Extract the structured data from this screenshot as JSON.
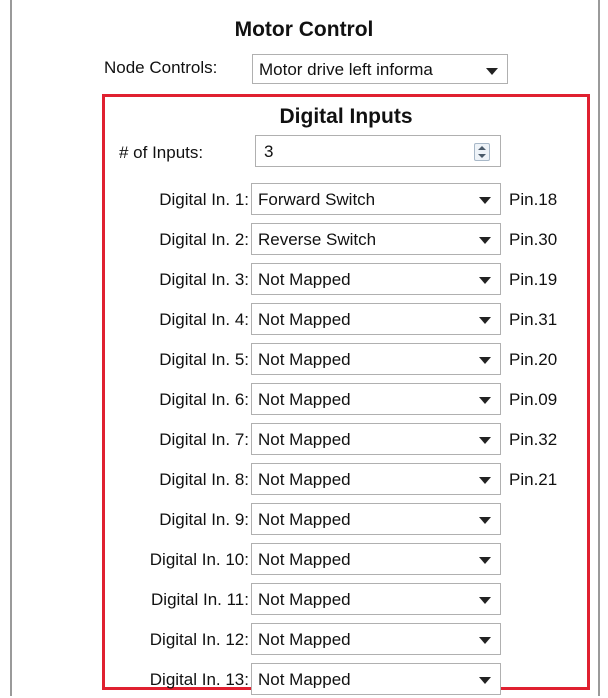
{
  "header": {
    "title": "Motor Control"
  },
  "node_controls": {
    "label": "Node Controls:",
    "value": "Motor drive left informa"
  },
  "digital_inputs": {
    "title": "Digital Inputs",
    "count_label": "# of Inputs:",
    "count_value": "3",
    "rows": [
      {
        "label": "Digital In. 1:",
        "value": "Forward Switch",
        "pin": "Pin.18"
      },
      {
        "label": "Digital In. 2:",
        "value": "Reverse Switch",
        "pin": "Pin.30"
      },
      {
        "label": "Digital In. 3:",
        "value": "Not Mapped",
        "pin": "Pin.19"
      },
      {
        "label": "Digital In. 4:",
        "value": "Not Mapped",
        "pin": "Pin.31"
      },
      {
        "label": "Digital In. 5:",
        "value": "Not Mapped",
        "pin": "Pin.20"
      },
      {
        "label": "Digital In. 6:",
        "value": "Not Mapped",
        "pin": "Pin.09"
      },
      {
        "label": "Digital In. 7:",
        "value": "Not Mapped",
        "pin": "Pin.32"
      },
      {
        "label": "Digital In. 8:",
        "value": "Not Mapped",
        "pin": "Pin.21"
      },
      {
        "label": "Digital In. 9:",
        "value": "Not Mapped",
        "pin": ""
      },
      {
        "label": "Digital In. 10:",
        "value": "Not Mapped",
        "pin": ""
      },
      {
        "label": "Digital In. 11:",
        "value": "Not Mapped",
        "pin": ""
      },
      {
        "label": "Digital In. 12:",
        "value": "Not Mapped",
        "pin": ""
      },
      {
        "label": "Digital In. 13:",
        "value": "Not Mapped",
        "pin": ""
      }
    ]
  },
  "colors": {
    "group_border": "#e02030",
    "frame_border": "#9a9a9a"
  },
  "icons": {
    "dropdown": "chevron-down-icon",
    "spinner": "spinner-arrows-icon"
  }
}
